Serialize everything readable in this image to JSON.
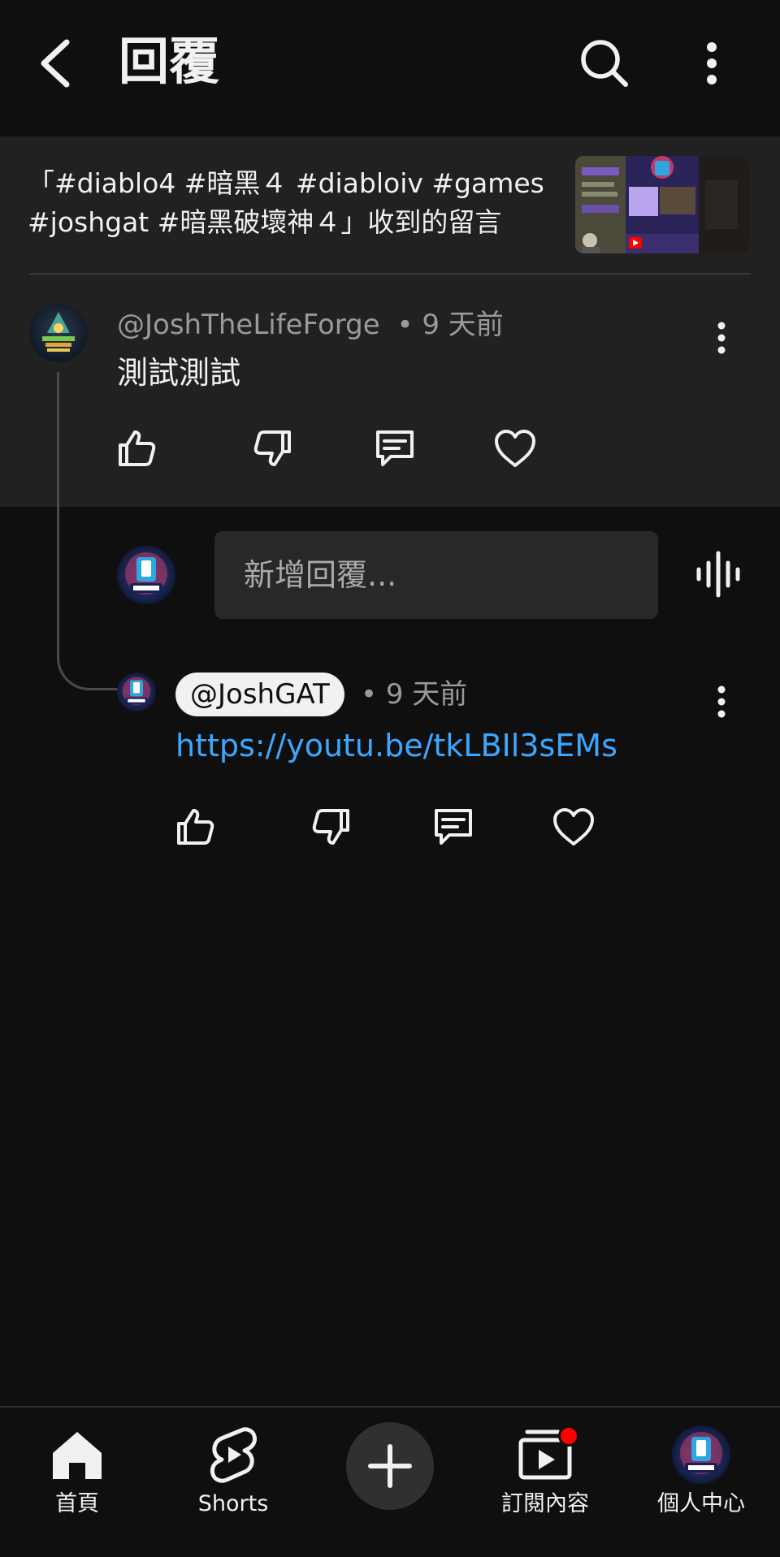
{
  "header": {
    "title": "回覆",
    "back_icon": "chevron-left-icon",
    "search_icon": "search-icon",
    "more_icon": "more-vertical-icon"
  },
  "video": {
    "caption_line1": "「#diablo4 #暗黑４ #diabloiv #games",
    "caption_line2": "#joshgat #暗黑破壞神４」收到的留言"
  },
  "comment": {
    "author": "@JoshTheLifeForge",
    "time": "• 9 天前",
    "text": "測試測試"
  },
  "reply_box": {
    "placeholder": "新增回覆..."
  },
  "reply": {
    "author": "@JoshGAT",
    "time": "• 9 天前",
    "text": "https://youtu.be/tkLBIl3sEMs"
  },
  "bottom_nav": {
    "items": [
      {
        "label": "首頁",
        "icon": "home-icon"
      },
      {
        "label": "Shorts",
        "icon": "shorts-icon"
      },
      {
        "label": "",
        "icon": "plus-icon"
      },
      {
        "label": "訂閱內容",
        "icon": "subscriptions-icon",
        "badge": true
      },
      {
        "label": "個人中心",
        "icon": "avatar"
      }
    ]
  },
  "colors": {
    "background": "#0f0f0f",
    "surface": "#212121",
    "link": "#3ea6ff",
    "badge": "#ff0000",
    "muted_text": "#9a9a9a"
  }
}
